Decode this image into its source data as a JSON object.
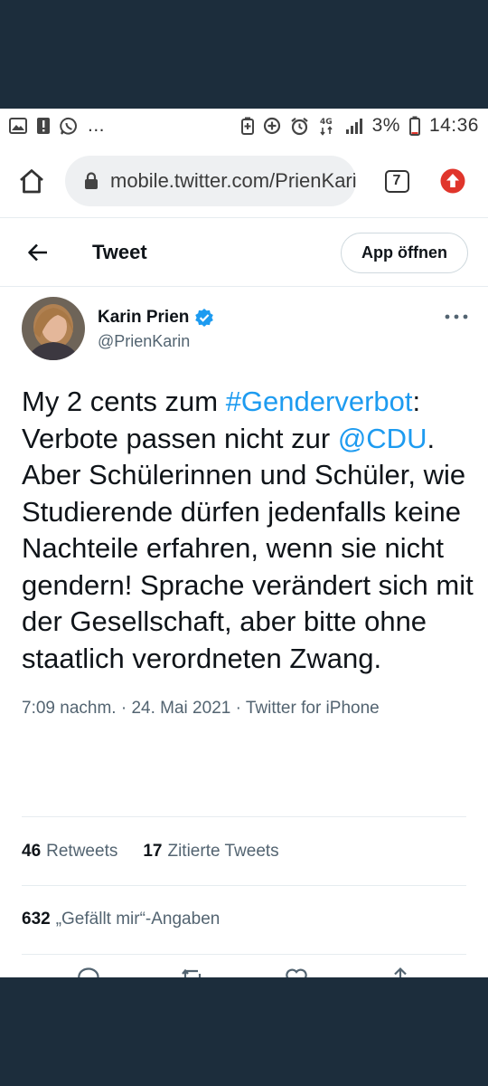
{
  "statusbar": {
    "dots": "...",
    "network": "4G",
    "battery": "3%",
    "time": "14:36",
    "icons": [
      "image-icon",
      "alert-icon",
      "whatsapp-icon",
      "battery-saver-icon",
      "data-saver-icon",
      "alarm-icon",
      "volte-icon",
      "signal-icon"
    ]
  },
  "browser": {
    "url": "mobile.twitter.com/PrienKarin",
    "tab_count": "7",
    "accent": "#e0352b"
  },
  "header": {
    "title": "Tweet",
    "open_app_label": "App öffnen"
  },
  "tweet": {
    "author_name": "Karin Prien",
    "author_handle": "@PrienKarin",
    "verified": true,
    "text_parts": {
      "p1": "My 2 cents zum ",
      "hashtag": "#Genderverbot",
      "p2": ": Verbote passen nicht zur ",
      "mention": "@CDU",
      "p3": ". Aber Schülerinnen und Schüler, wie Studierende dürfen jedenfalls keine Nachteile erfahren, wenn sie nicht gendern! Sprache verändert sich mit der Gesellschaft, aber bitte ohne staatlich verordneten Zwang."
    },
    "time": "7:09 nachm.",
    "separator": " · ",
    "date": "24. Mai 2021",
    "source": "Twitter for iPhone",
    "link_color": "#1d9bf0"
  },
  "stats": {
    "retweets_count": "46",
    "retweets_label": "Retweets",
    "quotes_count": "17",
    "quotes_label": "Zitierte Tweets",
    "likes_count": "632",
    "likes_label": "„Gefällt mir“-Angaben"
  }
}
